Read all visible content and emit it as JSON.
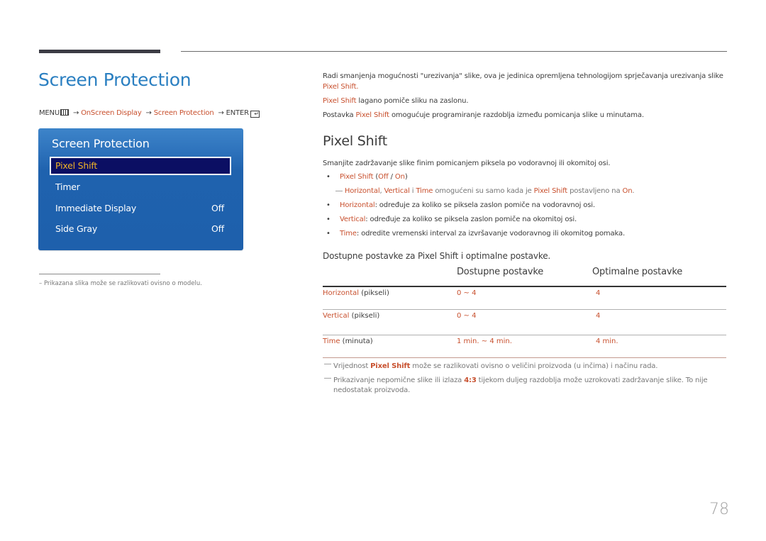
{
  "header": {
    "title": "Screen Protection"
  },
  "breadcrumb": {
    "menu": "MENU",
    "menu_icon": "menu-grid-icon",
    "arrow": "→",
    "items": [
      "OnScreen Display",
      "Screen Protection"
    ],
    "enter": "ENTER",
    "enter_icon": "enter-icon"
  },
  "osd_menu": {
    "title": "Screen Protection",
    "items": [
      {
        "label": "Pixel Shift",
        "value": "",
        "selected": true
      },
      {
        "label": "Timer",
        "value": ""
      },
      {
        "label": "Immediate Display",
        "value": "Off"
      },
      {
        "label": "Side Gray",
        "value": "Off"
      }
    ],
    "colors": {
      "panel": "#1e60ac",
      "selected_bg": "#0b0f63",
      "selected_text": "#f0b428"
    }
  },
  "left_footnote": "–  Prikazana slika može se razlikovati ovisno o modelu.",
  "intro": {
    "p1_text": "Radi smanjenja mogućnosti \"urezivanja\" slike, ova je jedinica opremljena tehnologijom sprječavanja urezivanja slike ",
    "p1_link": "Pixel Shift",
    "p1_end": ".",
    "p2_link": "Pixel Shift",
    "p2_text": " lagano pomiče sliku na zaslonu.",
    "p3_start": "Postavka ",
    "p3_link": "Pixel Shift",
    "p3_text": " omogućuje programiranje razdoblja između pomicanja slike u minutama."
  },
  "section": {
    "title": "Pixel Shift",
    "description": "Smanjite zadržavanje slike finim pomicanjem piksela po vodoravnoj ili okomitoj osi.",
    "bullet_main": {
      "label": "Pixel Shift",
      "open": " (",
      "off": "Off",
      "slash": " / ",
      "on": "On",
      "close": ")"
    },
    "note": {
      "dash": "―",
      "h": "Horizontal",
      "comma": ", ",
      "v": "Vertical",
      "and": " i ",
      "t": "Time",
      "text1": " omogućeni su samo kada je ",
      "ps": "Pixel Shift",
      "text2": " postavljeno na ",
      "on": "On",
      "end": "."
    },
    "bullets": [
      {
        "label": "Horizontal",
        "text": ": određuje za koliko se piksela zaslon pomiče na vodoravnoj osi."
      },
      {
        "label": "Vertical",
        "text": ": određuje za koliko se piksela zaslon pomiče na okomitoj osi."
      },
      {
        "label": "Time",
        "text": ": odredite vremenski interval za izvršavanje vodoravnog ili okomitog pomaka."
      }
    ]
  },
  "table": {
    "caption": "Dostupne postavke za Pixel Shift i optimalne postavke.",
    "headers": [
      "",
      "Dostupne postavke",
      "Optimalne postavke"
    ],
    "rows": [
      {
        "name": "Horizontal",
        "unit": " (pikseli)",
        "available": "0 ~ 4",
        "optimal": "4"
      },
      {
        "name": "Vertical",
        "unit": " (pikseli)",
        "available": "0 ~ 4",
        "optimal": "4"
      },
      {
        "name": "Time",
        "unit": " (minuta)",
        "available": "1 min. ~ 4 min.",
        "optimal": "4 min."
      }
    ]
  },
  "footnotes": [
    {
      "dash": "―",
      "a": "Vrijednost ",
      "b": "Pixel Shift",
      "c": " može se razlikovati ovisno o veličini proizvoda (u inčima) i načinu rada."
    },
    {
      "dash": "―",
      "a": "Prikazivanje nepomične slike ili izlaza ",
      "b": "4:3",
      "c": " tijekom duljeg razdoblja može uzrokovati zadržavanje slike. To nije nedostatak proizvoda."
    }
  ],
  "page_number": "78",
  "colors": {
    "accent_blue": "#2a7fc1",
    "link_red": "#c8502e",
    "text": "#3c3c3c",
    "muted": "#777777"
  }
}
